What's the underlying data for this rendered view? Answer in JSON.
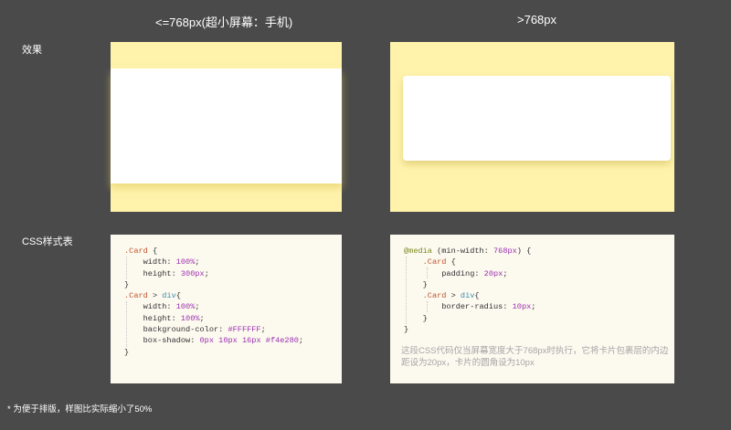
{
  "headers": {
    "left": "<=768px(超小屏幕：手机)",
    "right": ">768px"
  },
  "row_labels": {
    "effect": "效果",
    "css": "CSS样式表"
  },
  "colors": {
    "background": "#4a4a4a",
    "demo_bg": "#fff3ac",
    "code_bg": "#fcf9ef",
    "card": "#FFFFFF",
    "shadow": "#f4e280"
  },
  "code_left": {
    "l1_sel": ".Card",
    "l1_brace": " {",
    "l2_prop": "    width: ",
    "l2_val": "100%",
    "l2_end": ";",
    "l3_prop": "    height: ",
    "l3_val": "300px",
    "l3_end": ";",
    "l4": "}",
    "l5_sel": ".Card",
    "l5_gt": " > ",
    "l5_tag": "div",
    "l5_brace": "{",
    "l6_prop": "    width: ",
    "l6_val": "100%",
    "l6_end": ";",
    "l7_prop": "    height: ",
    "l7_val": "100%",
    "l7_end": ";",
    "l8_prop": "    background-color: ",
    "l8_val": "#FFFFFF",
    "l8_end": ";",
    "l9_prop": "    box-shadow: ",
    "l9_val1": "0px",
    "l9_sp1": " ",
    "l9_val2": "10px",
    "l9_sp2": " ",
    "l9_val3": "16px",
    "l9_sp3": " ",
    "l9_val4": "#f4e280",
    "l9_end": ";",
    "l10": "}"
  },
  "code_right": {
    "l1_at": "@media",
    "l1_rest": " (min-width: ",
    "l1_val": "768px",
    "l1_end": ") {",
    "l2_sel": "    .Card",
    "l2_brace": " {",
    "l3_prop": "        padding: ",
    "l3_val": "20px",
    "l3_end": ";",
    "l4": "    }",
    "l5_sel": "    .Card",
    "l5_gt": " > ",
    "l5_tag": "div",
    "l5_brace": "{",
    "l6_prop": "        border-radius: ",
    "l6_val": "10px",
    "l6_end": ";",
    "l7": "    }",
    "l8": "}"
  },
  "description": "这段CSS代码仅当屏幕宽度大于768px时执行，它将卡片包裹层的内边距设为20px，卡片的圆角设为10px",
  "footnote": "* 为便于排版，样图比实际缩小了50%"
}
